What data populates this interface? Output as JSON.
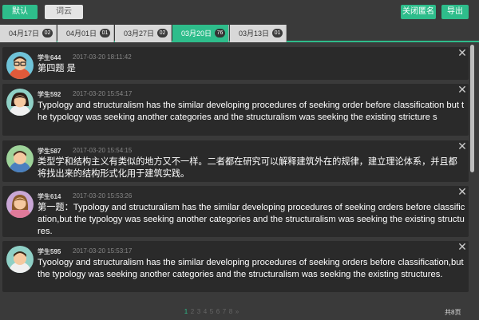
{
  "toolbar": {
    "default_label": "默认",
    "cloud_label": "词云",
    "anon_label": "关闭匿名",
    "export_label": "导出",
    "accent_color": "#2ebd8b"
  },
  "tabs": [
    {
      "date": "04月17日",
      "count": "02",
      "active": false
    },
    {
      "date": "04月01日",
      "count": "01",
      "active": false
    },
    {
      "date": "03月27日",
      "count": "02",
      "active": false
    },
    {
      "date": "03月20日",
      "count": "76",
      "active": true
    },
    {
      "date": "03月13日",
      "count": "01",
      "active": false
    }
  ],
  "posts": [
    {
      "name": "学生644",
      "time": "2017-03-20 18:11:42",
      "text": "第四题 是",
      "avatar": "male-glasses-avatar"
    },
    {
      "name": "学生592",
      "time": "2017-03-20 15:54:17",
      "text": "Typology and structuralism has the similar developing procedures of seeking order before classification but the typology was seeking another categories and the structuralism was seeking the existing stricture s",
      "avatar": "female-avatar"
    },
    {
      "name": "学生587",
      "time": "2017-03-20 15:54:15",
      "text": "类型学和结构主义有类似的地方又不一样。二者都在研究可以解释建筑外在的规律，建立理论体系，并且都将找出来的结构形式化用于建筑实践。",
      "avatar": "male-avatar"
    },
    {
      "name": "学生614",
      "time": "2017-03-20 15:53:26",
      "text": "第一题：Typology and structuralism has the similar developing procedures of seeking orders before classification,but the typology was seeking another categories and the structuralism was seeking the existing structures.",
      "avatar": "female-avatar"
    },
    {
      "name": "学生595",
      "time": "2017-03-20 15:53:17",
      "text": "Tyoology and structuralism has the similar developing procedures of seeking orders before classification,but the typology was seeking another categories and the structuralism was seeking the existing structures.",
      "avatar": "male-avatar"
    }
  ],
  "pager": {
    "pages": [
      "1",
      "2",
      "3",
      "4",
      "5",
      "6",
      "7",
      "8",
      "»"
    ],
    "current": "1",
    "total": "共8页"
  }
}
